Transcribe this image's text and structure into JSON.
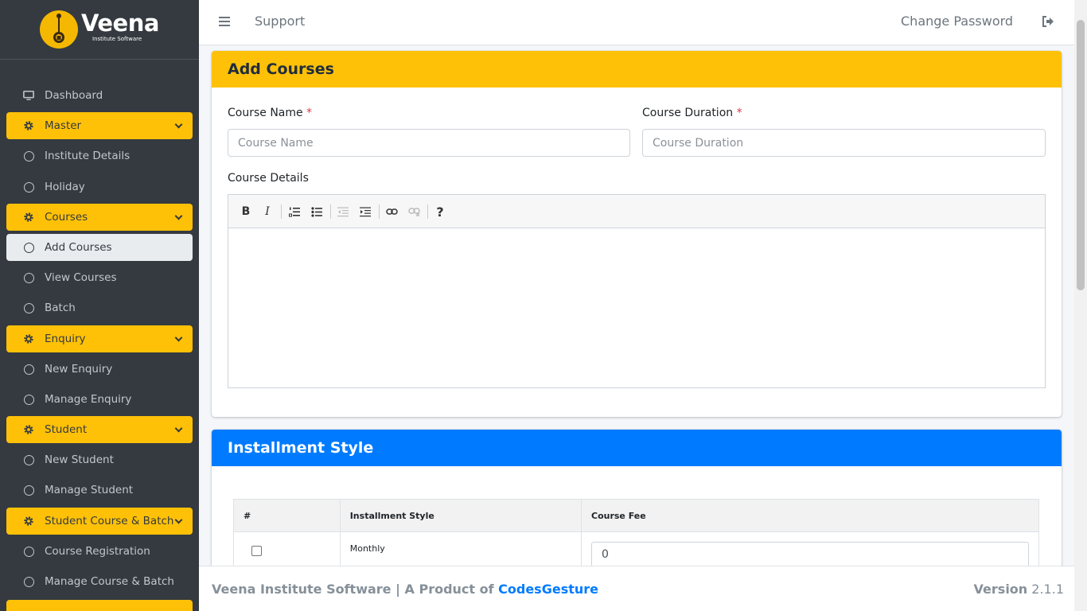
{
  "brand": {
    "name": "Veena",
    "subtitle": "Institute Software"
  },
  "sidebar": {
    "items": [
      {
        "label": "Dashboard",
        "type": "plain",
        "icon": "monitor-icon"
      },
      {
        "label": "Master",
        "type": "header",
        "icon": "gear-icon"
      },
      {
        "label": "Institute Details",
        "type": "circle"
      },
      {
        "label": "Holiday",
        "type": "circle"
      },
      {
        "label": "Courses",
        "type": "header",
        "icon": "gear-icon"
      },
      {
        "label": "Add Courses",
        "type": "circle",
        "active": true
      },
      {
        "label": "View Courses",
        "type": "circle"
      },
      {
        "label": "Batch",
        "type": "circle"
      },
      {
        "label": "Enquiry",
        "type": "header",
        "icon": "gear-icon"
      },
      {
        "label": "New Enquiry",
        "type": "circle"
      },
      {
        "label": "Manage Enquiry",
        "type": "circle"
      },
      {
        "label": "Student",
        "type": "header",
        "icon": "gear-icon"
      },
      {
        "label": "New Student",
        "type": "circle"
      },
      {
        "label": "Manage Student",
        "type": "circle"
      },
      {
        "label": "Student Course & Batch",
        "type": "header",
        "icon": "gear-icon"
      },
      {
        "label": "Course Registration",
        "type": "circle"
      },
      {
        "label": "Manage Course & Batch",
        "type": "circle"
      }
    ]
  },
  "topbar": {
    "support": "Support",
    "change_password": "Change Password"
  },
  "add_courses": {
    "title": "Add Courses",
    "course_name_label": "Course Name",
    "course_name_placeholder": "Course Name",
    "course_duration_label": "Course Duration",
    "course_duration_placeholder": "Course Duration",
    "required_mark": "*",
    "course_details_label": "Course Details",
    "toolbar": {
      "bold": "B",
      "italic": "I",
      "help": "?"
    }
  },
  "installment": {
    "title": "Installment Style",
    "columns": [
      "#",
      "Installment Style",
      "Course Fee"
    ],
    "rows": [
      {
        "style": "Monthly",
        "fee": "0"
      }
    ]
  },
  "footer": {
    "left_text": "Veena Institute Software | A Product of ",
    "link_text": "CodesGesture",
    "version_label": "Version",
    "version": "2.1.1"
  },
  "colors": {
    "sidebar": "#343a40",
    "accent": "#ffc107",
    "primary": "#007bff"
  }
}
